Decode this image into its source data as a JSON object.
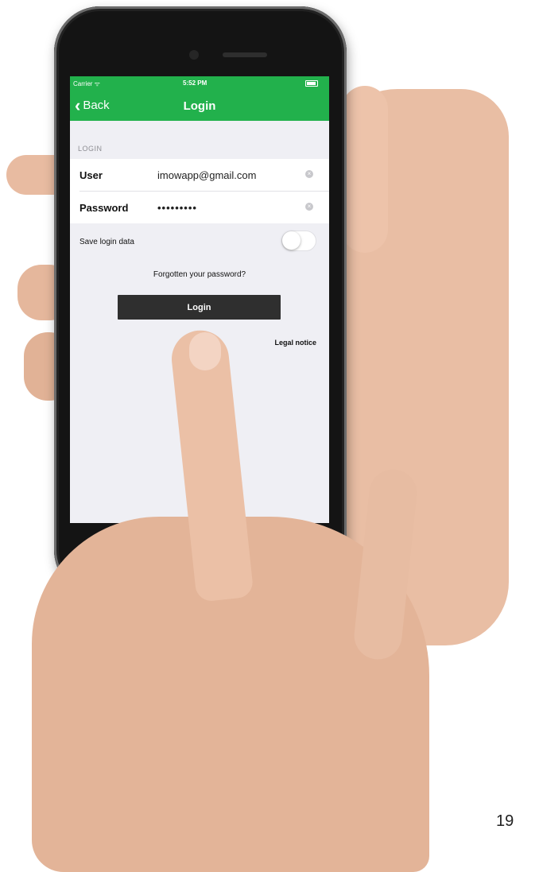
{
  "status_bar": {
    "carrier": "Carrier ᯤ",
    "time": "5:52 PM"
  },
  "nav": {
    "back_label": "Back",
    "title": "Login"
  },
  "form": {
    "section_header": "LOGIN",
    "user_label": "User",
    "user_value": "imowapp@gmail.com",
    "password_label": "Password",
    "password_value": "•••••••••",
    "save_label": "Save login data",
    "save_enabled": false,
    "forgot_link": "Forgotten your password?",
    "login_button": "Login",
    "legal_link": "Legal notice"
  },
  "colors": {
    "accent": "#22b14c",
    "button": "#2f2f2f",
    "background": "#efeff4"
  },
  "icons": {
    "back": "chevron-left-icon",
    "clear": "clear-circle-icon"
  },
  "page_number": "19"
}
